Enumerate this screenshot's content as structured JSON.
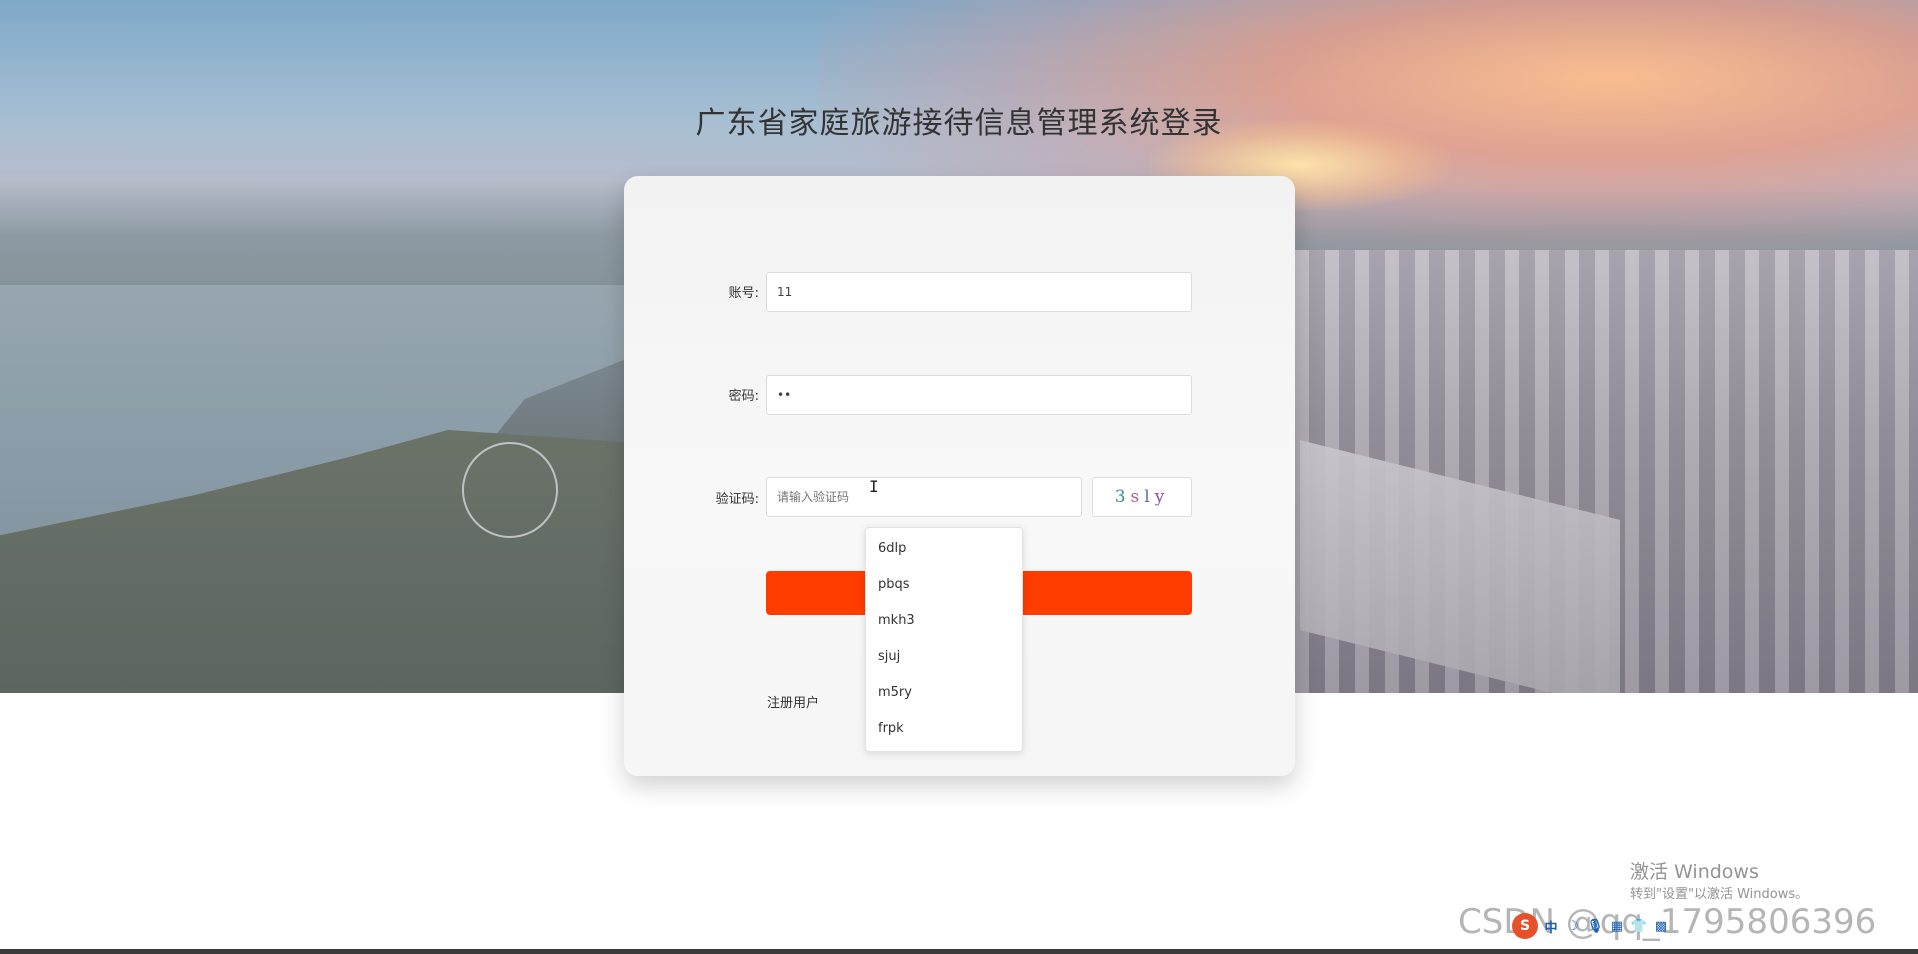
{
  "page": {
    "title": "广东省家庭旅游接待信息管理系统登录"
  },
  "form": {
    "account_label": "账号:",
    "account_value": "11",
    "password_label": "密码:",
    "password_value": "••",
    "captcha_label": "验证码:",
    "captcha_placeholder": "请输入验证码",
    "captcha_chars": [
      "3",
      "s",
      "l",
      "y"
    ],
    "login_button": "",
    "register_link": "注册用户"
  },
  "autocomplete": {
    "items": [
      "6dlp",
      "pbqs",
      "mkh3",
      "sjuj",
      "m5ry",
      "frpk"
    ]
  },
  "windows": {
    "activate_title": "激活 Windows",
    "activate_sub": "转到\"设置\"以激活 Windows。"
  },
  "watermark": {
    "text": "CSDN @qq_1795806396"
  },
  "ime": {
    "logo": "S",
    "icons": [
      "中",
      "☽",
      "🎙",
      "▦",
      "👕",
      "▩"
    ]
  },
  "colors": {
    "accent": "#ff3c00",
    "title": "#333333",
    "card_bg": "#f6f6f6"
  }
}
